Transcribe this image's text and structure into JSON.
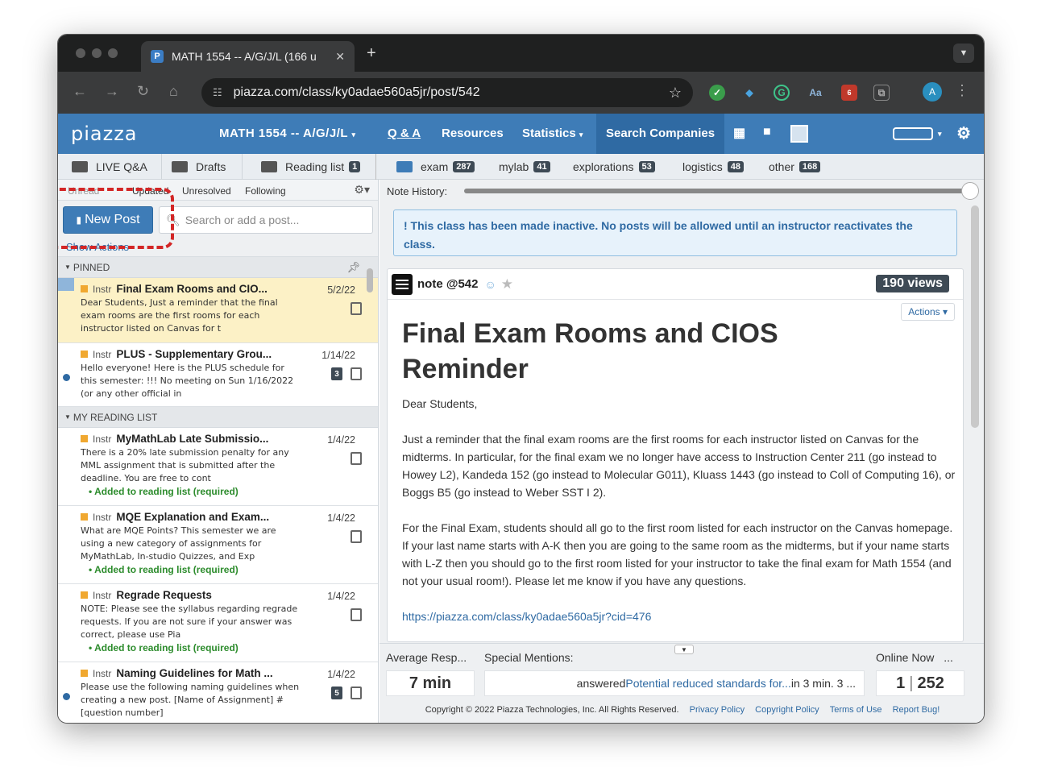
{
  "browser": {
    "tab_title": "MATH 1554 -- A/G/J/L (166 u",
    "tab_favicon": "P",
    "url": "piazza.com/class/ky0adae560a5jr/post/542",
    "profile_initial": "A",
    "ext_badge": "6"
  },
  "header": {
    "logo": "piazza",
    "class_name": "MATH 1554 -- A/G/J/L",
    "nav_qa": "Q & A",
    "nav_resources": "Resources",
    "nav_statistics": "Statistics",
    "nav_search_companies": "Search Companies"
  },
  "folders": {
    "live_qa": "LIVE Q&A",
    "drafts": "Drafts",
    "reading_list": "Reading list",
    "reading_list_count": "1",
    "tags": [
      {
        "name": "exam",
        "count": "287"
      },
      {
        "name": "mylab",
        "count": "41"
      },
      {
        "name": "explorations",
        "count": "53"
      },
      {
        "name": "logistics",
        "count": "48"
      },
      {
        "name": "other",
        "count": "168"
      }
    ]
  },
  "filters": {
    "unread": "Unread",
    "updated": "Updated",
    "unresolved": "Unresolved",
    "following": "Following"
  },
  "actions": {
    "new_post": "New Post",
    "search_placeholder": "Search or add a post...",
    "show_actions": "Show Actions"
  },
  "sections": {
    "pinned": "PINNED",
    "reading": "MY READING LIST"
  },
  "instr_label": "Instr",
  "added_label": "Added to reading list (required)",
  "posts": [
    {
      "title": "Final Exam Rooms and CIO...",
      "date": "5/2/22",
      "body": "Dear Students, Just a reminder that the final exam rooms are the first rooms for each instructor listed on Canvas for t"
    },
    {
      "title": "PLUS - Supplementary Grou...",
      "date": "1/14/22",
      "body": "Hello everyone! Here is the PLUS schedule for this semester: !!! No meeting on Sun 1/16/2022 (or any other official in",
      "badge": "3"
    },
    {
      "title": "MyMathLab Late Submissio...",
      "date": "1/4/22",
      "body": "There is a 20% late submission penalty for any MML assignment that is submitted after the deadline. You are free to cont"
    },
    {
      "title": "MQE Explanation and Exam...",
      "date": "1/4/22",
      "body": "What are MQE Points? This semester we are using a new category of assignments for MyMathLab, In-studio Quizzes, and Exp"
    },
    {
      "title": "Regrade Requests",
      "date": "1/4/22",
      "body": "NOTE: Please see the syllabus regarding regrade requests. If you are not sure if your answer was correct, please use Pia"
    },
    {
      "title": "Naming Guidelines for Math ...",
      "date": "1/4/22",
      "body": "Please use the following naming guidelines when creating a new post. [Name of Assignment] #[question number]",
      "badge": "5"
    }
  ],
  "note_history": "Note History:",
  "inactive_msg": "! This class has been made inactive. No posts will be allowed until an instructor reactivates the class.",
  "note": {
    "label": "note @542",
    "views": "190 views",
    "actions": "Actions",
    "title": "Final Exam Rooms and CIOS Reminder",
    "greeting": "Dear Students,",
    "para1": "Just a reminder that the final exam rooms are the first rooms for each instructor listed on Canvas for the midterms. In particular, for the final exam we no longer have access to Instruction Center 211 (go instead to Howey L2), Kandeda 152 (go instead to Molecular G011), Kluass 1443 (go instead to Coll of Computing 16), or Boggs B5 (go instead to Weber SST I 2).",
    "para2": "For the Final Exam, students should all go to the first room listed for each instructor on the Canvas homepage. If your last name starts with A-K then you are going to the same room as the midterms, but if your name starts with L-Z then you should go to the first room listed for your instructor to take the final exam for Math 1554 (and not your usual room!). Please let me know if you have any questions.",
    "link": "https://piazza.com/class/ky0adae560a5jr?cid=476"
  },
  "stats": {
    "avg_label": "Average Resp...",
    "avg_value": "7 min",
    "mentions_label": "Special Mentions:",
    "mention_prefix": "answered ",
    "mention_link": "Potential reduced standards for...",
    "mention_suffix": " in 3 min. 3 ...",
    "online_label": "Online Now",
    "online_more": "...",
    "online_now": "1",
    "online_total": "252"
  },
  "footer": {
    "copyright": "Copyright © 2022 Piazza Technologies, Inc. All Rights Reserved.",
    "privacy": "Privacy Policy",
    "copyright_policy": "Copyright Policy",
    "terms": "Terms of Use",
    "report": "Report Bug!"
  },
  "colors": {
    "piazza_blue": "#3e7cb7",
    "selected_post": "#fcf1c6",
    "highlight_dash": "#d32626"
  }
}
